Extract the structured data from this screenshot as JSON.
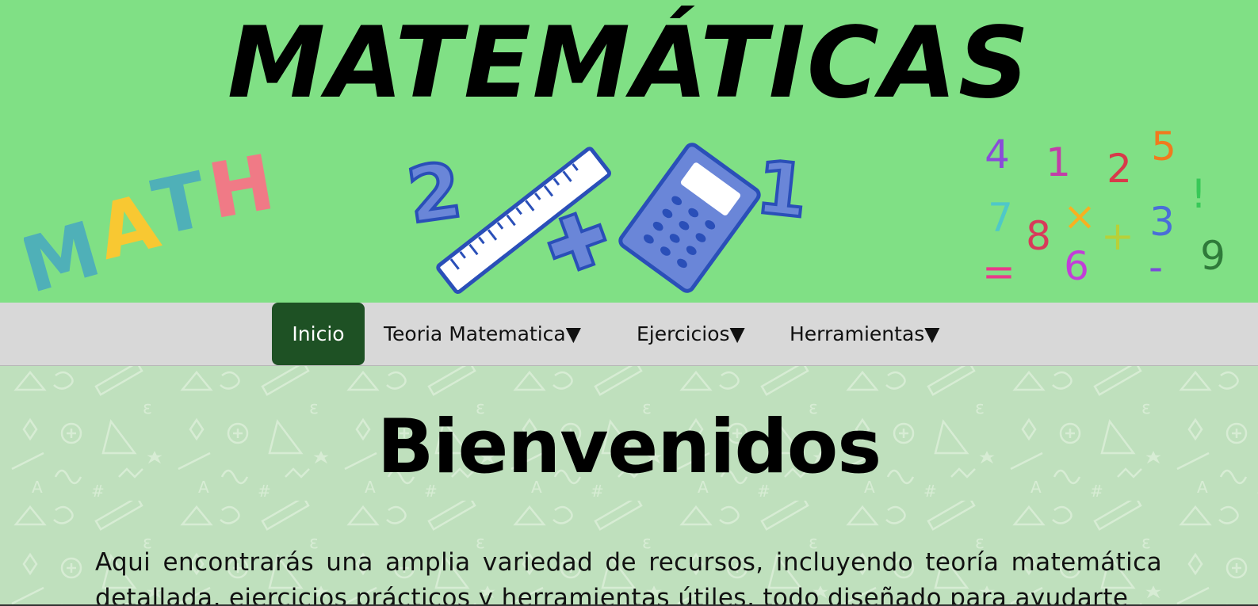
{
  "banner": {
    "title": "MATEMÁTICAS",
    "math_word": "MATH",
    "numbers": [
      "4",
      "1",
      "2",
      "5",
      "7",
      "8",
      "×",
      "+",
      "3",
      "!",
      "=",
      "6",
      "-",
      "9"
    ],
    "tool_digits": [
      "2",
      "1"
    ]
  },
  "nav": {
    "items": [
      {
        "label": "Inicio"
      },
      {
        "label": "Teoria Matematica▼"
      },
      {
        "label": "Ejercicios▼"
      },
      {
        "label": "Herramientas▼"
      }
    ]
  },
  "main": {
    "heading": "Bienvenidos",
    "intro": "Aqui encontrarás una amplia variedad de recursos, incluyendo teoría matemática detallada, ejercicios prácticos y herramientas útiles, todo diseñado para ayudarte"
  },
  "colors": {
    "banner_bg": "#80e085",
    "nav_bg": "#d8d8d8",
    "nav_active": "#1e5124",
    "content_bg": "#bfe0bd"
  }
}
